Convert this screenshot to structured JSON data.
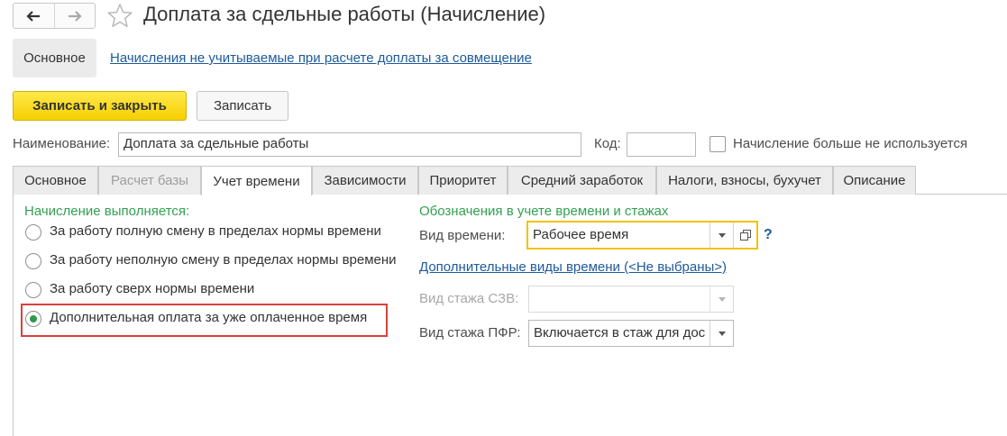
{
  "window": {
    "title": "Доплата за сдельные работы (Начисление)",
    "back_icon": "arrow-left-icon",
    "forward_icon": "arrow-right-icon",
    "favorite_icon": "star-icon"
  },
  "sections": {
    "main_label": "Основное",
    "link_label": "Начисления не учитываемые при расчете доплаты за совмещение"
  },
  "toolbar": {
    "save_close_label": "Записать и закрыть",
    "save_label": "Записать"
  },
  "header": {
    "name_label": "Наименование:",
    "name_value": "Доплата за сдельные работы",
    "code_label": "Код:",
    "code_value": "",
    "unused_label": "Начисление больше не используется",
    "unused_checked": false
  },
  "tabs": [
    {
      "label": "Основное",
      "state": "normal"
    },
    {
      "label": "Расчет базы",
      "state": "disabled"
    },
    {
      "label": "Учет времени",
      "state": "active"
    },
    {
      "label": "Зависимости",
      "state": "normal"
    },
    {
      "label": "Приоритет",
      "state": "normal"
    },
    {
      "label": "Средний заработок",
      "state": "normal"
    },
    {
      "label": "Налоги, взносы, бухучет",
      "state": "normal"
    },
    {
      "label": "Описание",
      "state": "normal"
    }
  ],
  "accrual": {
    "group_title": "Начисление выполняется:",
    "options": [
      {
        "label": "За работу полную смену в пределах нормы времени",
        "selected": false
      },
      {
        "label": "За работу неполную смену в пределах нормы времени",
        "selected": false
      },
      {
        "label": "За работу сверх нормы времени",
        "selected": false
      },
      {
        "label": "Дополнительная оплата за уже оплаченное время",
        "selected": true
      }
    ]
  },
  "time_tracking": {
    "group_title": "Обозначения в учете времени и стажах",
    "time_kind_label": "Вид времени:",
    "time_kind_value": "Рабочее время",
    "help_label": "?",
    "extra_kinds_link": "Дополнительные виды времени (<Не выбраны>)",
    "szv_label": "Вид стажа СЗВ:",
    "szv_value": "",
    "pfr_label": "Вид стажа ПФР:",
    "pfr_value": "Включается в стаж для дос"
  },
  "colors": {
    "accent_yellow": "#f5cf00",
    "group_green": "#32a052",
    "link_blue": "#1d5a9a",
    "highlight_red": "#d9423c"
  }
}
